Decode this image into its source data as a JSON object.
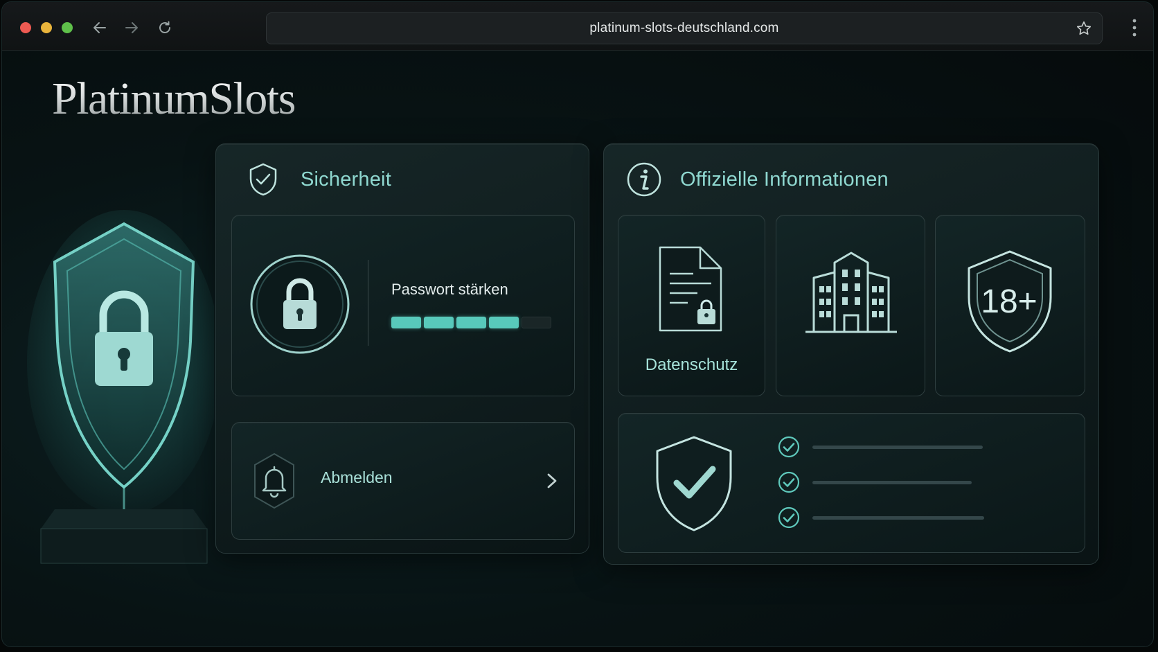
{
  "browser": {
    "url": "platinum-slots-deutschland.com",
    "icons": [
      "back-arrow-icon",
      "forward-arrow-icon",
      "reload-icon",
      "star-icon",
      "kebab-menu-icon"
    ]
  },
  "brand": {
    "logo_text": "PlatinumSlots"
  },
  "security_panel": {
    "title": "Sicherheit",
    "password": {
      "label": "Passwort stärken",
      "strength_segments_total": 5,
      "strength_segments_filled": 4
    },
    "logout": {
      "label": "Abmelden"
    }
  },
  "info_panel": {
    "title": "Offizielle Informationen",
    "cards": [
      {
        "id": "privacy",
        "label": "Datenschutz",
        "icon": "document-lock-icon"
      },
      {
        "id": "company",
        "label": "",
        "icon": "building-icon"
      },
      {
        "id": "age",
        "badge": "18+",
        "icon": "age-shield-icon"
      }
    ],
    "checklist_count": 3
  },
  "colors": {
    "accent": "#58c9bb",
    "title": "#8fd8d0",
    "background": "#081314"
  }
}
